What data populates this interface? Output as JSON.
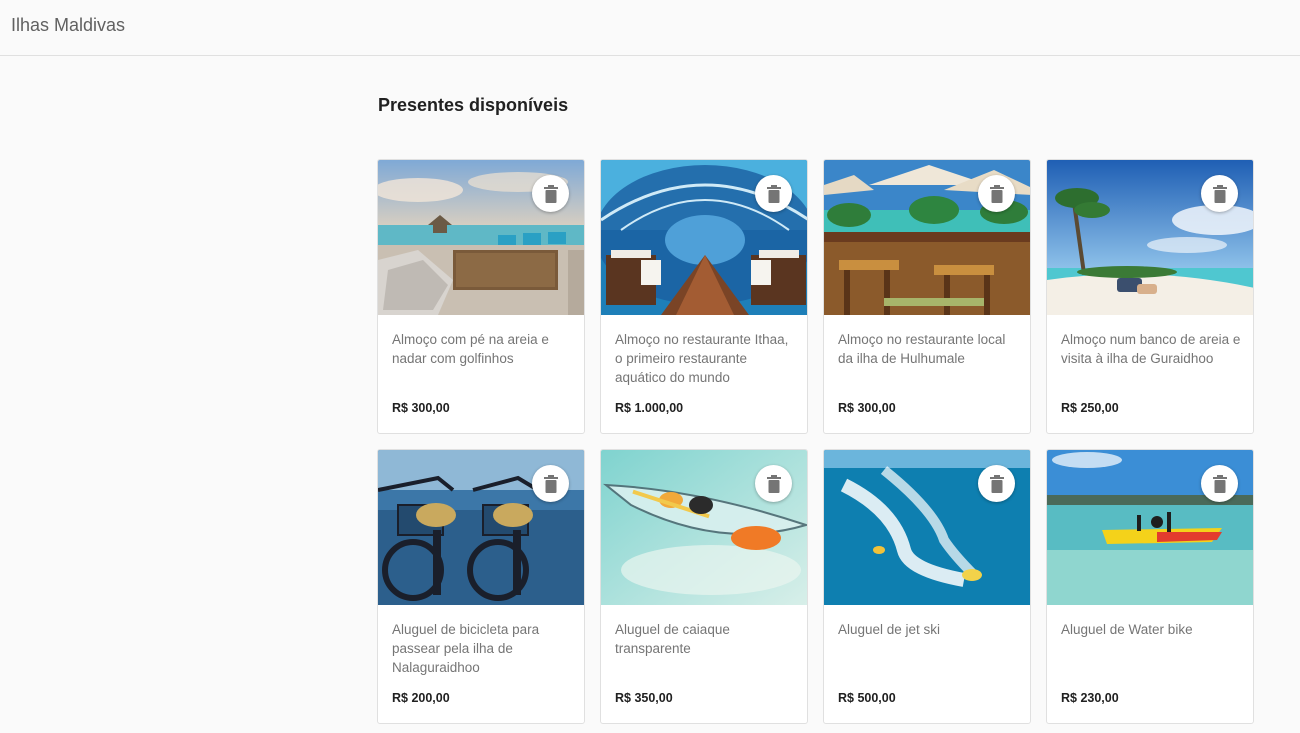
{
  "header": {
    "title": "Ilhas Maldivas"
  },
  "main": {
    "section_title": "Presentes disponíveis",
    "gifts": [
      {
        "description": "Almoço com pé na areia e nadar com golfinhos",
        "price": "R$ 300,00",
        "image": "beach-lounge-restaurant"
      },
      {
        "description": "Almoço no restaurante Ithaa, o primeiro restaurante aquático do mundo",
        "price": "R$ 1.000,00",
        "image": "underwater-restaurant"
      },
      {
        "description": "Almoço no restaurante local da ilha de Hulhumale",
        "price": "R$ 300,00",
        "image": "terrace-restaurant"
      },
      {
        "description": "Almoço num banco de areia e visita à ilha de Guraidhoo",
        "price": "R$ 250,00",
        "image": "sandbank-beach"
      },
      {
        "description": "Aluguel de bicicleta para passear pela ilha de Nalaguraidhoo",
        "price": "R$ 200,00",
        "image": "bicycles"
      },
      {
        "description": "Aluguel de caiaque transparente",
        "price": "R$ 350,00",
        "image": "transparent-kayak"
      },
      {
        "description": "Aluguel de jet ski",
        "price": "R$ 500,00",
        "image": "jet-ski"
      },
      {
        "description": "Aluguel de Water bike",
        "price": "R$ 230,00",
        "image": "water-bike"
      }
    ]
  },
  "icons": {
    "delete": "trash-icon"
  }
}
